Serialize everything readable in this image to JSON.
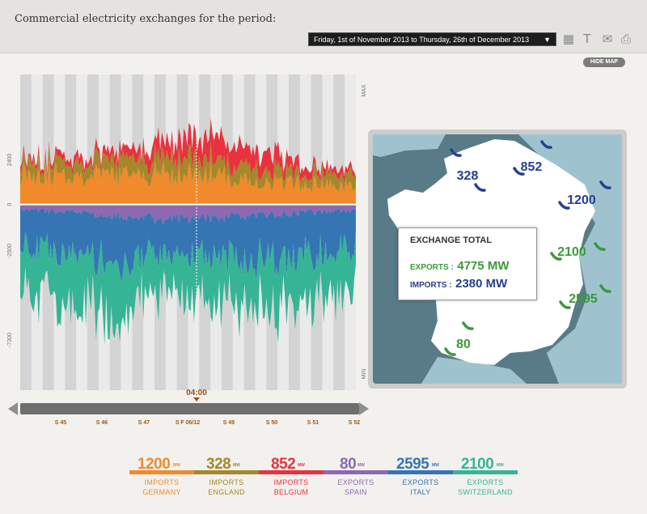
{
  "header": {
    "title": "Commercial electricity exchanges for the period:",
    "date_range": "Friday, 1st of November 2013  to  Thursday, 26th of December 2013",
    "tools": [
      {
        "name": "calendar-icon",
        "glyph": "▦"
      },
      {
        "name": "today-icon",
        "glyph": "T"
      },
      {
        "name": "share-icon",
        "glyph": "✉"
      },
      {
        "name": "print-icon",
        "glyph": "⎙"
      }
    ],
    "hide_map": "HIDE MAP"
  },
  "colors": {
    "germany": "#f08a2c",
    "england": "#a4882a",
    "belgium": "#e8323d",
    "spain": "#8e68b1",
    "italy": "#3575b4",
    "switzerland": "#35b496",
    "exports_text": "#3a9a3a",
    "imports_text": "#26408f",
    "sea": "#587b87",
    "neighbor": "#9ec3cf",
    "france": "#ffffff"
  },
  "chart_data": {
    "type": "area",
    "title": "",
    "y_tick_labels": [
      "MAX",
      "2400",
      "0",
      "-2500",
      "-7300",
      "MIN"
    ],
    "x_tick_labels": [
      "S 45",
      "S 46",
      "S 47",
      "S  F 06/12",
      "S 49",
      "S 50",
      "S 51",
      "S 52"
    ],
    "cursor_label": "04:00",
    "ylim": [
      -10000,
      7000
    ],
    "series": [
      {
        "name": "Germany",
        "direction": "import",
        "values": [
          1800,
          1600,
          1500,
          1700,
          1600,
          1200,
          1100,
          900
        ]
      },
      {
        "name": "England",
        "direction": "import",
        "values": [
          600,
          700,
          800,
          900,
          850,
          700,
          500,
          600
        ]
      },
      {
        "name": "Belgium",
        "direction": "import",
        "values": [
          200,
          300,
          400,
          900,
          1200,
          1100,
          400,
          300
        ]
      },
      {
        "name": "Spain",
        "direction": "export",
        "values": [
          -300,
          -400,
          -600,
          -800,
          -700,
          -600,
          -400,
          -300
        ]
      },
      {
        "name": "Italy",
        "direction": "export",
        "values": [
          -1800,
          -2200,
          -2600,
          -1800,
          -2000,
          -2400,
          -2200,
          -1900
        ]
      },
      {
        "name": "Switzerland",
        "direction": "export",
        "values": [
          -2300,
          -2600,
          -3000,
          -2000,
          -2400,
          -2800,
          -2500,
          -2200
        ]
      }
    ]
  },
  "map": {
    "totals_title": "EXCHANGE TOTAL",
    "exports_label": "EXPORTS :",
    "exports_value": "4775 MW",
    "imports_label": "IMPORTS :",
    "imports_value": "2380 MW",
    "values": [
      {
        "text": "328",
        "kind": "import"
      },
      {
        "text": "852",
        "kind": "import"
      },
      {
        "text": "1200",
        "kind": "import"
      },
      {
        "text": "2100",
        "kind": "export"
      },
      {
        "text": "2595",
        "kind": "export"
      },
      {
        "text": "80",
        "kind": "export"
      }
    ]
  },
  "legend": [
    {
      "value": "1200",
      "unit": "MW",
      "line1": "IMPORTS",
      "line2": "GERMANY",
      "color": "#f08a2c"
    },
    {
      "value": "328",
      "unit": "MW",
      "line1": "IMPORTS",
      "line2": "ENGLAND",
      "color": "#a4882a"
    },
    {
      "value": "852",
      "unit": "MW",
      "line1": "IMPORTS",
      "line2": "BELGIUM",
      "color": "#e8323d"
    },
    {
      "value": "80",
      "unit": "MW",
      "line1": "EXPORTS",
      "line2": "SPAIN",
      "color": "#8e68b1"
    },
    {
      "value": "2595",
      "unit": "MW",
      "line1": "EXPORTS",
      "line2": "ITALY",
      "color": "#3575b4"
    },
    {
      "value": "2100",
      "unit": "MW",
      "line1": "EXPORTS",
      "line2": "SWITZERLAND",
      "color": "#35b496"
    }
  ]
}
